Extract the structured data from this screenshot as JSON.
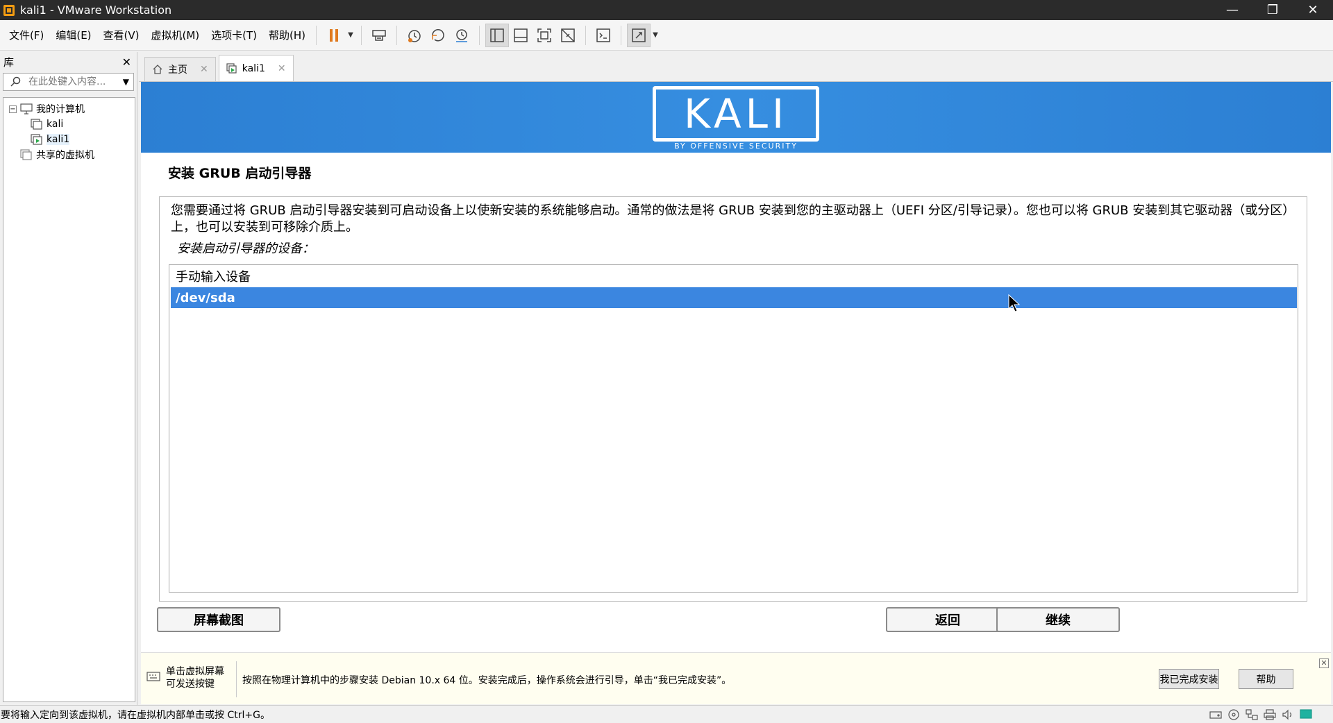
{
  "window": {
    "title": "kali1 - VMware Workstation",
    "minimize": "—",
    "restore": "❐",
    "close": "✕"
  },
  "menu": [
    "文件(F)",
    "编辑(E)",
    "查看(V)",
    "虚拟机(M)",
    "选项卡(T)",
    "帮助(H)"
  ],
  "toolbar": {
    "pause_color": "#e07a1f",
    "icons": [
      "pause-icon",
      "send-ctrl-alt-del-icon",
      "snapshot-icon",
      "revert-snapshot-icon",
      "snapshot-manager-icon",
      "library-view-icon",
      "thumbnail-view-icon",
      "fullscreen-icon",
      "unity-icon",
      "console-icon",
      "stretch-icon"
    ]
  },
  "library": {
    "title": "库",
    "search_placeholder": "在此处键入内容...",
    "tree": {
      "root": "我的计算机",
      "vms": [
        "kali",
        "kali1"
      ],
      "shared": "共享的虚拟机"
    }
  },
  "tabs": [
    {
      "label": "主页",
      "icon": "home-icon"
    },
    {
      "label": "kali1",
      "icon": "vm-icon"
    }
  ],
  "guest": {
    "logo_text": "KALI",
    "logo_sub": "BY OFFENSIVE SECURITY",
    "banner_color": "#368ee0",
    "title": "安装 GRUB 启动引导器",
    "description": "您需要通过将 GRUB 启动引导器安装到可启动设备上以使新安装的系统能够启动。通常的做法是将 GRUB 安装到您的主驱动器上（UEFI 分区/引导记录）。您也可以将 GRUB 安装到其它驱动器（或分区）上，也可以安装到可移除介质上。",
    "device_label": "安装启动引导器的设备：",
    "options": [
      "手动输入设备",
      "/dev/sda"
    ],
    "selected_index": 1,
    "selection_color": "#3b86e0",
    "buttons": {
      "screenshot": "屏幕截图",
      "back": "返回",
      "continue": "继续"
    }
  },
  "hint": {
    "left_line1": "单击虚拟屏幕",
    "left_line2": "可发送按键",
    "text": "按照在物理计算机中的步骤安装 Debian 10.x 64 位。安装完成后，操作系统会进行引导，单击“我已完成安装”。",
    "done_button": "我已完成安装",
    "help_button": "帮助",
    "close": "✕"
  },
  "status": {
    "text": "要将输入定向到该虚拟机，请在虚拟机内部单击或按 Ctrl+G。"
  }
}
